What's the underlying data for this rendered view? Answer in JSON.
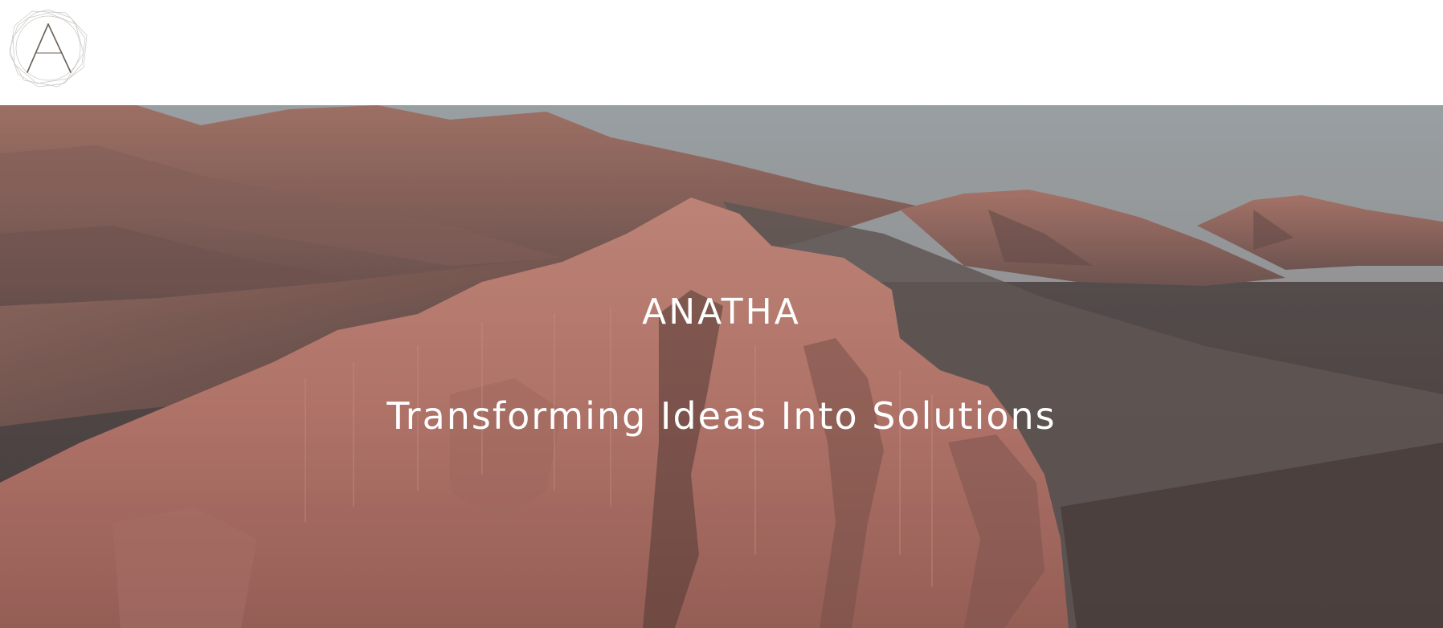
{
  "header": {
    "logo_icon": "anatha-logo-icon",
    "logo_letter": "A"
  },
  "hero": {
    "brand": "ANATHA",
    "tagline": "Transforming Ideas Into Solutions",
    "colors": {
      "sky_top": "#b0b6b8",
      "sky_horizon": "#8a8485",
      "rock": "#c98478",
      "shadow": "#4a3f3e",
      "valley": "#5b5250"
    }
  }
}
